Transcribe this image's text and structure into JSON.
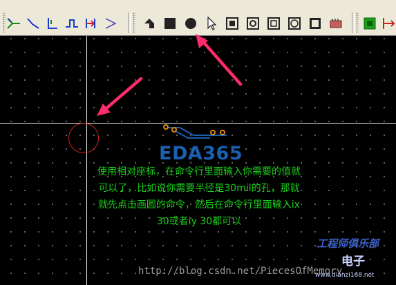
{
  "toolbar": {
    "icons": [
      "route-icon",
      "arc-route-icon",
      "fanout-icon",
      "diff-pair-icon",
      "stub-icon",
      "arrow-wire-icon",
      "keepout-icon",
      "rectangle-icon",
      "circle-icon",
      "pointer-icon",
      "pad-icon",
      "via-icon",
      "square-pad-icon",
      "round-pad-icon",
      "text-icon",
      "component-icon",
      "board-icon",
      "dimension-icon"
    ]
  },
  "canvas": {
    "logo_text": "EDA365",
    "annotation_lines": [
      "使用相对座标，在命令行里面输入你需要的值就",
      "可以了，比如说你需要半径是30mil的孔，那就",
      "就先点击画圆的命令，然后在命令行里面输入ix",
      "30或者iy 30都可以"
    ],
    "watermark_url": "http://blog.csdn.net/PiecesOfMemory",
    "watermark_club": "工程师俱乐部",
    "watermark_elec": "电子",
    "watermark_site": "www.dianzi168.net"
  },
  "colors": {
    "annotation": "#19d019",
    "arrow": "#ff2b6a",
    "circle": "#e02020",
    "logo": "#1b5fb0"
  }
}
